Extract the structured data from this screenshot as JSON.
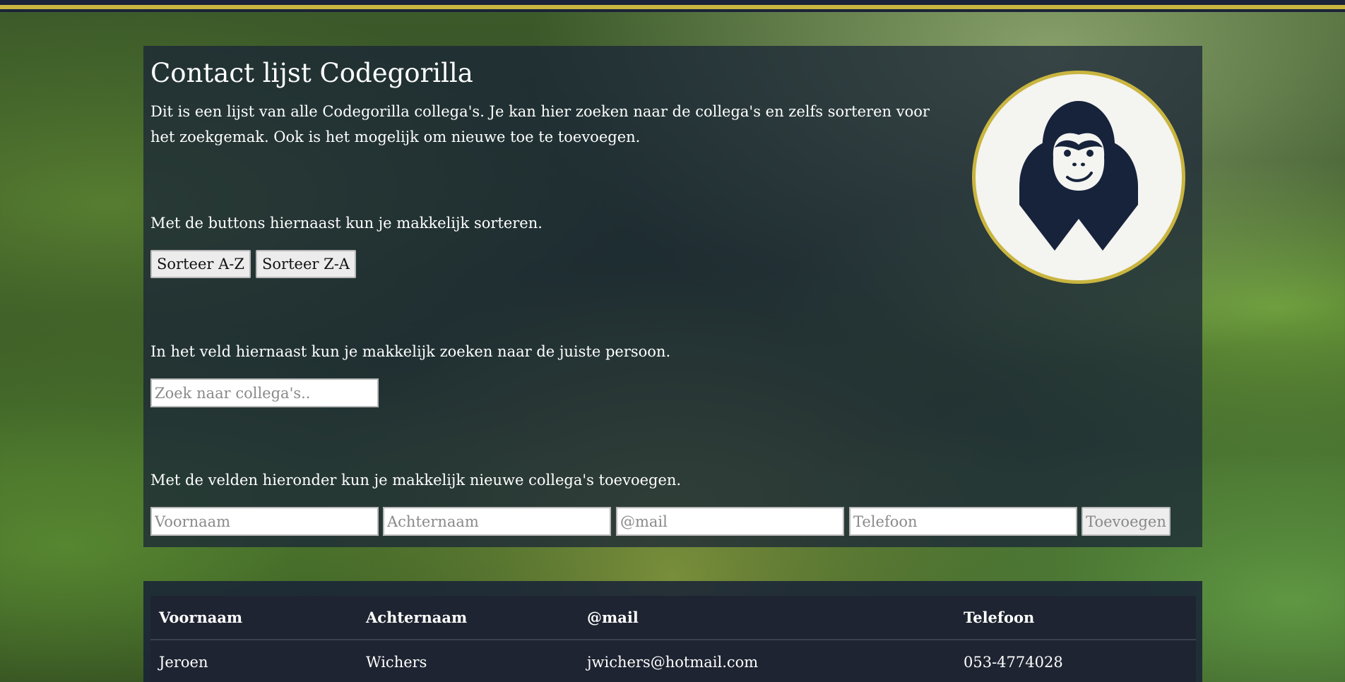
{
  "colors": {
    "accent": "#c9b53f",
    "panel": "#182137",
    "table_bg": "#1e2431",
    "logo_dark": "#17233b"
  },
  "header": {
    "title": "Contact lijst Codegorilla",
    "intro": "Dit is een lijst van alle Codegorilla collega's. Je kan hier zoeken naar de collega's en zelfs sorteren voor het zoekgemak. Ook is het mogelijk om nieuwe toe te toevoegen."
  },
  "sort": {
    "text": "Met de buttons hiernaast kun je makkelijk sorteren.",
    "az_label": "Sorteer A-Z",
    "za_label": "Sorteer Z-A"
  },
  "search": {
    "text": "In het veld hiernaast kun je makkelijk zoeken naar de juiste persoon.",
    "placeholder": "Zoek naar collega's.."
  },
  "add": {
    "text": "Met de velden hieronder kun je makkelijk nieuwe collega's toevoegen.",
    "first_placeholder": "Voornaam",
    "last_placeholder": "Achternaam",
    "mail_placeholder": "@mail",
    "phone_placeholder": "Telefoon",
    "submit_label": "Toevoegen"
  },
  "logo": {
    "icon": "gorilla-logo-icon"
  },
  "table": {
    "headers": [
      "Voornaam",
      "Achternaam",
      "@mail",
      "Telefoon"
    ],
    "rows": [
      [
        "Jeroen",
        "Wichers",
        "jwichers@hotmail.com",
        "053-4774028"
      ]
    ]
  }
}
